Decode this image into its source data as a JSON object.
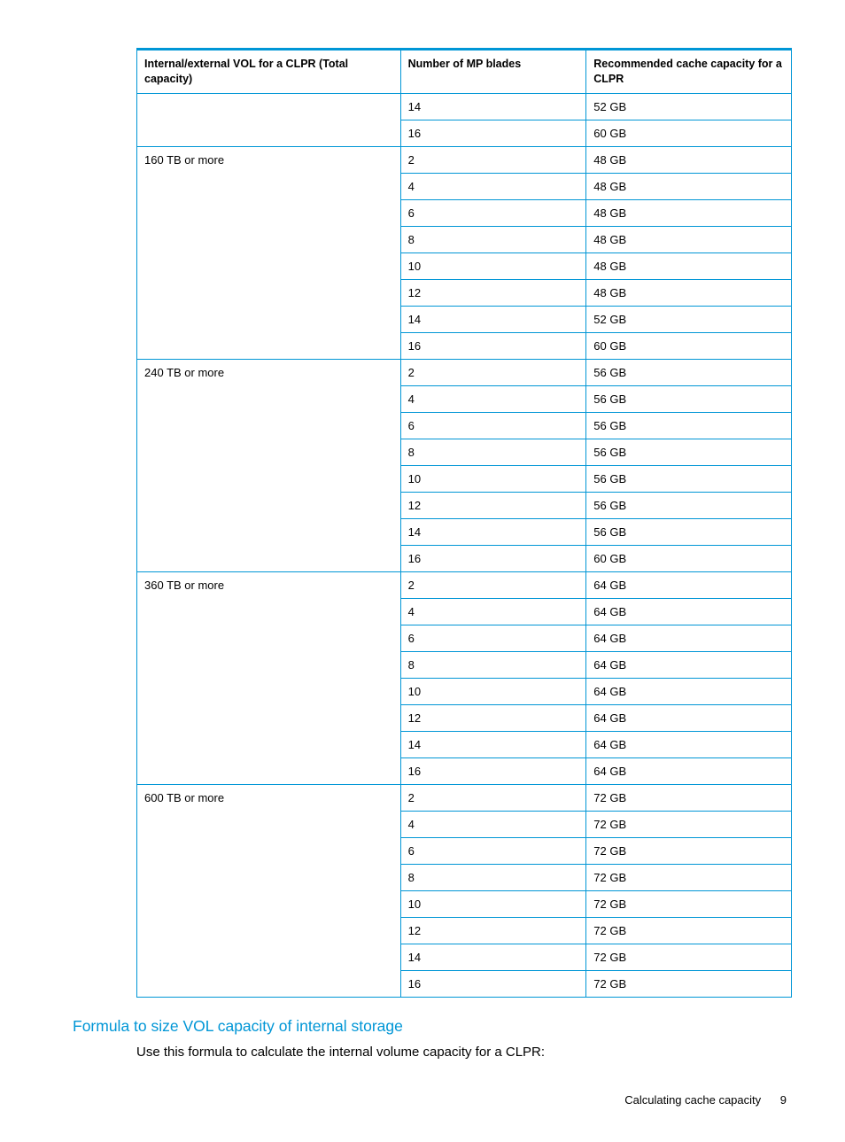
{
  "table": {
    "headers": [
      "Internal/external VOL for a CLPR (Total capacity)",
      "Number of MP blades",
      "Recommended cache capacity for a CLPR"
    ],
    "groups": [
      {
        "label": "",
        "rows": [
          {
            "blades": "14",
            "cache": "52 GB"
          },
          {
            "blades": "16",
            "cache": "60 GB"
          }
        ]
      },
      {
        "label": "160 TB or more",
        "rows": [
          {
            "blades": "2",
            "cache": "48 GB"
          },
          {
            "blades": "4",
            "cache": "48 GB"
          },
          {
            "blades": "6",
            "cache": "48 GB"
          },
          {
            "blades": "8",
            "cache": "48 GB"
          },
          {
            "blades": "10",
            "cache": "48 GB"
          },
          {
            "blades": "12",
            "cache": "48 GB"
          },
          {
            "blades": "14",
            "cache": "52 GB"
          },
          {
            "blades": "16",
            "cache": "60 GB"
          }
        ]
      },
      {
        "label": "240 TB or more",
        "rows": [
          {
            "blades": "2",
            "cache": "56 GB"
          },
          {
            "blades": "4",
            "cache": "56 GB"
          },
          {
            "blades": "6",
            "cache": "56 GB"
          },
          {
            "blades": "8",
            "cache": "56 GB"
          },
          {
            "blades": "10",
            "cache": "56 GB"
          },
          {
            "blades": "12",
            "cache": "56 GB"
          },
          {
            "blades": "14",
            "cache": "56 GB"
          },
          {
            "blades": "16",
            "cache": "60 GB"
          }
        ]
      },
      {
        "label": "360 TB or more",
        "rows": [
          {
            "blades": "2",
            "cache": "64 GB"
          },
          {
            "blades": "4",
            "cache": "64 GB"
          },
          {
            "blades": "6",
            "cache": "64 GB"
          },
          {
            "blades": "8",
            "cache": "64 GB"
          },
          {
            "blades": "10",
            "cache": "64 GB"
          },
          {
            "blades": "12",
            "cache": "64 GB"
          },
          {
            "blades": "14",
            "cache": "64 GB"
          },
          {
            "blades": "16",
            "cache": "64 GB"
          }
        ]
      },
      {
        "label": "600 TB or more",
        "rows": [
          {
            "blades": "2",
            "cache": "72 GB"
          },
          {
            "blades": "4",
            "cache": "72 GB"
          },
          {
            "blades": "6",
            "cache": "72 GB"
          },
          {
            "blades": "8",
            "cache": "72 GB"
          },
          {
            "blades": "10",
            "cache": "72 GB"
          },
          {
            "blades": "12",
            "cache": "72 GB"
          },
          {
            "blades": "14",
            "cache": "72 GB"
          },
          {
            "blades": "16",
            "cache": "72 GB"
          }
        ]
      }
    ]
  },
  "section_heading": "Formula to size VOL capacity of internal storage",
  "body_text": "Use this formula to calculate the internal volume capacity for a CLPR:",
  "footer": {
    "title": "Calculating cache capacity",
    "page": "9"
  }
}
